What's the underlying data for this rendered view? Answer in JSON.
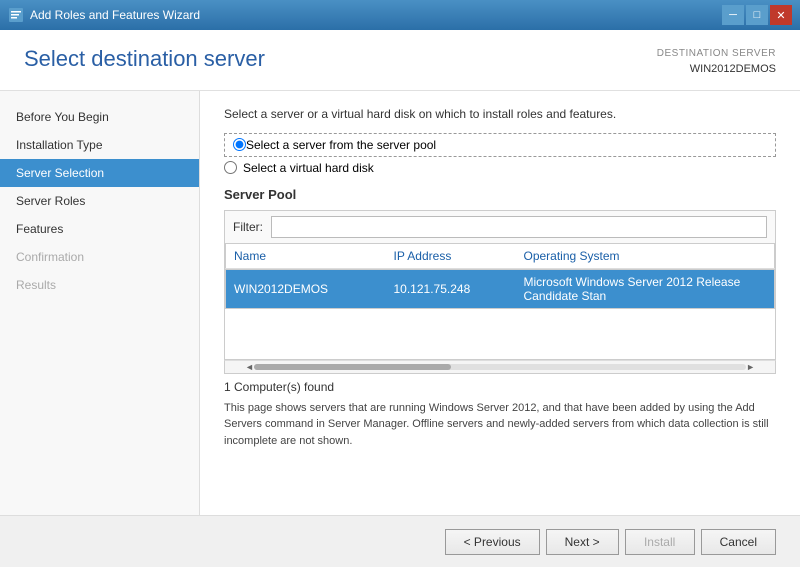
{
  "titlebar": {
    "title": "Add Roles and Features Wizard",
    "icon": "wizard-icon"
  },
  "header": {
    "title": "Select destination server",
    "destination_label": "DESTINATION SERVER",
    "destination_value": "WIN2012DEMOS"
  },
  "sidebar": {
    "items": [
      {
        "label": "Before You Begin",
        "state": "normal"
      },
      {
        "label": "Installation Type",
        "state": "normal"
      },
      {
        "label": "Server Selection",
        "state": "active"
      },
      {
        "label": "Server Roles",
        "state": "normal"
      },
      {
        "label": "Features",
        "state": "normal"
      },
      {
        "label": "Confirmation",
        "state": "disabled"
      },
      {
        "label": "Results",
        "state": "disabled"
      }
    ]
  },
  "main": {
    "instruction": "Select a server or a virtual hard disk on which to install roles and features.",
    "radio_options": [
      {
        "id": "radio_server",
        "label": "Select a server from the server pool",
        "selected": true
      },
      {
        "id": "radio_vhd",
        "label": "Select a virtual hard disk",
        "selected": false
      }
    ],
    "server_pool": {
      "section_title": "Server Pool",
      "filter_label": "Filter:",
      "filter_placeholder": "",
      "columns": [
        {
          "label": "Name"
        },
        {
          "label": "IP Address"
        },
        {
          "label": "Operating System"
        }
      ],
      "rows": [
        {
          "name": "WIN2012DEMOS",
          "ip": "10.121.75.248",
          "os": "Microsoft Windows Server 2012 Release Candidate Stan",
          "selected": true
        }
      ]
    },
    "computers_found": "1 Computer(s) found",
    "description": "This page shows servers that are running Windows Server 2012, and that have been added by using the Add Servers command in Server Manager. Offline servers and newly-added servers from which data collection is still incomplete are not shown."
  },
  "footer": {
    "previous_label": "< Previous",
    "next_label": "Next >",
    "install_label": "Install",
    "cancel_label": "Cancel"
  },
  "titlebar_controls": {
    "minimize": "─",
    "maximize": "□",
    "close": "✕"
  }
}
